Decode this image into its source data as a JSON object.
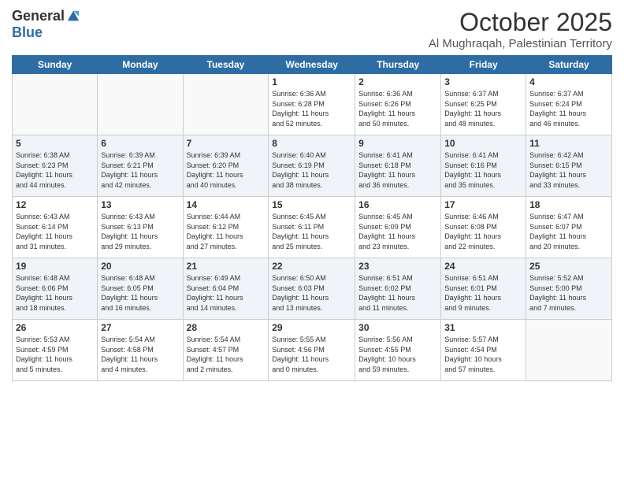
{
  "header": {
    "logo_general": "General",
    "logo_blue": "Blue",
    "month": "October 2025",
    "location": "Al Mughraqah, Palestinian Territory"
  },
  "weekdays": [
    "Sunday",
    "Monday",
    "Tuesday",
    "Wednesday",
    "Thursday",
    "Friday",
    "Saturday"
  ],
  "weeks": [
    [
      {
        "day": "",
        "info": ""
      },
      {
        "day": "",
        "info": ""
      },
      {
        "day": "",
        "info": ""
      },
      {
        "day": "1",
        "info": "Sunrise: 6:36 AM\nSunset: 6:28 PM\nDaylight: 11 hours\nand 52 minutes."
      },
      {
        "day": "2",
        "info": "Sunrise: 6:36 AM\nSunset: 6:26 PM\nDaylight: 11 hours\nand 50 minutes."
      },
      {
        "day": "3",
        "info": "Sunrise: 6:37 AM\nSunset: 6:25 PM\nDaylight: 11 hours\nand 48 minutes."
      },
      {
        "day": "4",
        "info": "Sunrise: 6:37 AM\nSunset: 6:24 PM\nDaylight: 11 hours\nand 46 minutes."
      }
    ],
    [
      {
        "day": "5",
        "info": "Sunrise: 6:38 AM\nSunset: 6:23 PM\nDaylight: 11 hours\nand 44 minutes."
      },
      {
        "day": "6",
        "info": "Sunrise: 6:39 AM\nSunset: 6:21 PM\nDaylight: 11 hours\nand 42 minutes."
      },
      {
        "day": "7",
        "info": "Sunrise: 6:39 AM\nSunset: 6:20 PM\nDaylight: 11 hours\nand 40 minutes."
      },
      {
        "day": "8",
        "info": "Sunrise: 6:40 AM\nSunset: 6:19 PM\nDaylight: 11 hours\nand 38 minutes."
      },
      {
        "day": "9",
        "info": "Sunrise: 6:41 AM\nSunset: 6:18 PM\nDaylight: 11 hours\nand 36 minutes."
      },
      {
        "day": "10",
        "info": "Sunrise: 6:41 AM\nSunset: 6:16 PM\nDaylight: 11 hours\nand 35 minutes."
      },
      {
        "day": "11",
        "info": "Sunrise: 6:42 AM\nSunset: 6:15 PM\nDaylight: 11 hours\nand 33 minutes."
      }
    ],
    [
      {
        "day": "12",
        "info": "Sunrise: 6:43 AM\nSunset: 6:14 PM\nDaylight: 11 hours\nand 31 minutes."
      },
      {
        "day": "13",
        "info": "Sunrise: 6:43 AM\nSunset: 6:13 PM\nDaylight: 11 hours\nand 29 minutes."
      },
      {
        "day": "14",
        "info": "Sunrise: 6:44 AM\nSunset: 6:12 PM\nDaylight: 11 hours\nand 27 minutes."
      },
      {
        "day": "15",
        "info": "Sunrise: 6:45 AM\nSunset: 6:11 PM\nDaylight: 11 hours\nand 25 minutes."
      },
      {
        "day": "16",
        "info": "Sunrise: 6:45 AM\nSunset: 6:09 PM\nDaylight: 11 hours\nand 23 minutes."
      },
      {
        "day": "17",
        "info": "Sunrise: 6:46 AM\nSunset: 6:08 PM\nDaylight: 11 hours\nand 22 minutes."
      },
      {
        "day": "18",
        "info": "Sunrise: 6:47 AM\nSunset: 6:07 PM\nDaylight: 11 hours\nand 20 minutes."
      }
    ],
    [
      {
        "day": "19",
        "info": "Sunrise: 6:48 AM\nSunset: 6:06 PM\nDaylight: 11 hours\nand 18 minutes."
      },
      {
        "day": "20",
        "info": "Sunrise: 6:48 AM\nSunset: 6:05 PM\nDaylight: 11 hours\nand 16 minutes."
      },
      {
        "day": "21",
        "info": "Sunrise: 6:49 AM\nSunset: 6:04 PM\nDaylight: 11 hours\nand 14 minutes."
      },
      {
        "day": "22",
        "info": "Sunrise: 6:50 AM\nSunset: 6:03 PM\nDaylight: 11 hours\nand 13 minutes."
      },
      {
        "day": "23",
        "info": "Sunrise: 6:51 AM\nSunset: 6:02 PM\nDaylight: 11 hours\nand 11 minutes."
      },
      {
        "day": "24",
        "info": "Sunrise: 6:51 AM\nSunset: 6:01 PM\nDaylight: 11 hours\nand 9 minutes."
      },
      {
        "day": "25",
        "info": "Sunrise: 5:52 AM\nSunset: 5:00 PM\nDaylight: 11 hours\nand 7 minutes."
      }
    ],
    [
      {
        "day": "26",
        "info": "Sunrise: 5:53 AM\nSunset: 4:59 PM\nDaylight: 11 hours\nand 5 minutes."
      },
      {
        "day": "27",
        "info": "Sunrise: 5:54 AM\nSunset: 4:58 PM\nDaylight: 11 hours\nand 4 minutes."
      },
      {
        "day": "28",
        "info": "Sunrise: 5:54 AM\nSunset: 4:57 PM\nDaylight: 11 hours\nand 2 minutes."
      },
      {
        "day": "29",
        "info": "Sunrise: 5:55 AM\nSunset: 4:56 PM\nDaylight: 11 hours\nand 0 minutes."
      },
      {
        "day": "30",
        "info": "Sunrise: 5:56 AM\nSunset: 4:55 PM\nDaylight: 10 hours\nand 59 minutes."
      },
      {
        "day": "31",
        "info": "Sunrise: 5:57 AM\nSunset: 4:54 PM\nDaylight: 10 hours\nand 57 minutes."
      },
      {
        "day": "",
        "info": ""
      }
    ]
  ]
}
